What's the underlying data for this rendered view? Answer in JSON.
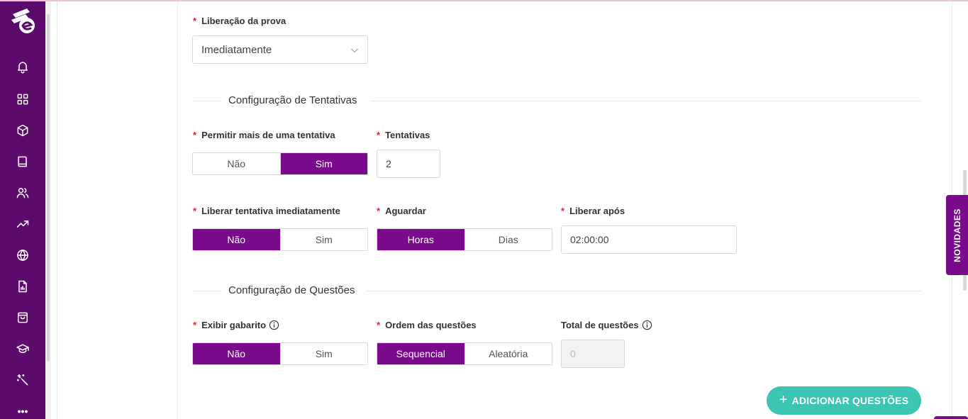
{
  "sidebar": {
    "items": [
      {
        "icon": "bell-icon"
      },
      {
        "icon": "grid-icon"
      },
      {
        "icon": "cube-icon"
      },
      {
        "icon": "book-icon"
      },
      {
        "icon": "users-icon"
      },
      {
        "icon": "trending-up-icon"
      },
      {
        "icon": "globe-icon"
      },
      {
        "icon": "report-icon"
      },
      {
        "icon": "shopping-bag-icon"
      },
      {
        "icon": "graduation-cap-icon"
      },
      {
        "icon": "magic-wand-icon"
      }
    ],
    "more": "•••",
    "bg_color": "#5d0a6d"
  },
  "release": {
    "label": "Liberação da prova",
    "value": "Imediatamente"
  },
  "attempts_section": {
    "title": "Configuração de Tentativas",
    "allow_multiple": {
      "label": "Permitir mais de uma tentativa",
      "options": [
        "Não",
        "Sim"
      ],
      "selected": "Sim"
    },
    "attempts": {
      "label": "Tentativas",
      "value": "2"
    },
    "release_immediately": {
      "label": "Liberar tentativa imediatamente",
      "options": [
        "Não",
        "Sim"
      ],
      "selected": "Não"
    },
    "wait": {
      "label": "Aguardar",
      "options": [
        "Horas",
        "Dias"
      ],
      "selected": "Horas"
    },
    "release_after": {
      "label": "Liberar após",
      "value": "02:00:00"
    }
  },
  "questions_section": {
    "title": "Configuração de Questões",
    "show_answers": {
      "label": "Exibir gabarito",
      "options": [
        "Não",
        "Sim"
      ],
      "selected": "Não"
    },
    "order": {
      "label": "Ordem das questões",
      "options": [
        "Sequencial",
        "Aleatória"
      ],
      "selected": "Sequencial"
    },
    "total": {
      "label": "Total de questões",
      "value": "0"
    }
  },
  "add_questions_button": "ADICIONAR QUESTÕES",
  "novidades_tab": "NOVIDADES",
  "colors": {
    "accent": "#7a0a8c",
    "teal": "#3cc5b2",
    "required": "#e0202d"
  }
}
